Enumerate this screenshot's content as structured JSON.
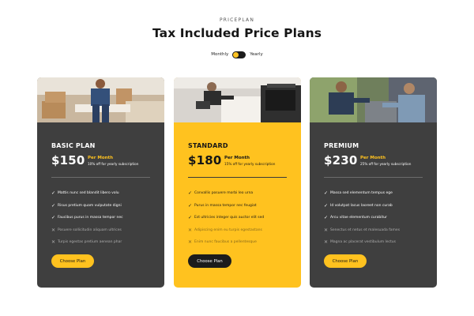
{
  "header": {
    "eyebrow": "PRICEPLAN",
    "title": "Tax Included Price Plans",
    "toggle": {
      "left_label": "Monthly",
      "right_label": "Yearly",
      "selected": "Monthly"
    }
  },
  "colors": {
    "accent": "#ffc21f",
    "card_dark": "#3f3f3f",
    "text_dark": "#161616"
  },
  "plans": [
    {
      "name": "BASIC PLAN",
      "price": "$150",
      "period": "Per Month",
      "note": "10% off for yearly subscription",
      "image": "mover-carrying-box-photo",
      "features": [
        {
          "text": "Mattis nunc sed blandit libero volu",
          "included": true
        },
        {
          "text": "Risus pretium quam vulputate digni",
          "included": true
        },
        {
          "text": "Faucibus purus in massa tempor nec",
          "included": true
        },
        {
          "text": "Posuere sollicitudin aliquam ultrices",
          "included": false
        },
        {
          "text": "Turpis egestas pretium aenean phar",
          "included": false
        }
      ],
      "button": "Choose Plan"
    },
    {
      "name": "STANDARD",
      "price": "$180",
      "period": "Per Month",
      "note": "15% off for yearly subscription",
      "image": "technician-fixing-cabinet-photo",
      "features": [
        {
          "text": "Convallis posuere morbi leo urna",
          "included": true
        },
        {
          "text": "Purus in massa tempor nec feugiat",
          "included": true
        },
        {
          "text": "Est ultricies integer quis auctor elit sed",
          "included": true
        },
        {
          "text": "Adipiscing enim eu turpis egestastans",
          "included": false
        },
        {
          "text": "Enim nunc faucibus a pellentesque",
          "included": false
        }
      ],
      "button": "Choose Plan"
    },
    {
      "name": "PREMIUM",
      "price": "$230",
      "period": "Per Month",
      "note": "25% off for yearly subscription",
      "image": "technicians-repairing-ac-photo",
      "features": [
        {
          "text": "Massa sed elementum tempus ege",
          "included": true
        },
        {
          "text": "Id volutpat lacus laoreet non curab",
          "included": true
        },
        {
          "text": "Arcu vitae elementum curabitur",
          "included": true
        },
        {
          "text": "Senectus et netus et malesuada fames",
          "included": false
        },
        {
          "text": "Magna ac placerat vestibulum lectus",
          "included": false
        }
      ],
      "button": "Choose Plan"
    }
  ]
}
